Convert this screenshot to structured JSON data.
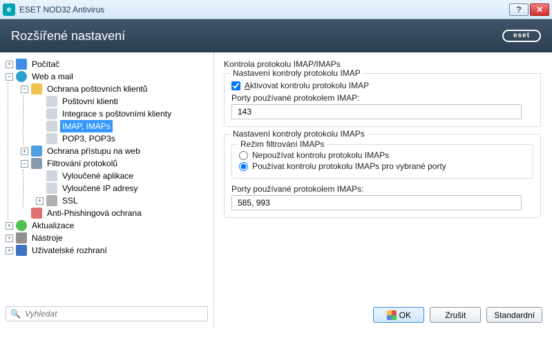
{
  "window": {
    "title": "ESET NOD32 Antivirus",
    "header": "Rozšířené nastavení",
    "brand": "eset"
  },
  "tree": {
    "computer": "Počítač",
    "web_mail": "Web a mail",
    "mail_protection": "Ochrana poštovních klientů",
    "mail_clients": "Poštovní klienti",
    "mail_integration": "Integrace s poštovními klienty",
    "imap": "IMAP, IMAPs",
    "pop3": "POP3, POP3s",
    "web_access": "Ochrana přístupu na web",
    "protocol_filtering": "Filtrování protokolů",
    "excluded_apps": "Vyloučené aplikace",
    "excluded_ips": "Vyloučené IP adresy",
    "ssl": "SSL",
    "antiphishing": "Anti-Phishingová ochrana",
    "update": "Aktualizace",
    "tools": "Nástroje",
    "ui": "Uživatelské rozhraní"
  },
  "search": {
    "placeholder": "Vyhledat"
  },
  "content": {
    "title": "Kontrola protokolu IMAP/IMAPs",
    "imap_group": "Nastavení kontroly protokolu IMAP",
    "imap_checkbox_prefix": "A",
    "imap_checkbox_rest": "ktivovat kontrolu protokolu IMAP",
    "imap_checked": true,
    "imap_ports_label_prefix": "Po",
    "imap_ports_label_u": "r",
    "imap_ports_label_rest": "ty používané protokolem IMAP:",
    "imap_ports_value": "143",
    "imaps_group": "Nastavení kontroly protokolu IMAPs",
    "imaps_mode_group": "Režim filtrování IMAPs",
    "imaps_radio_off_u": "N",
    "imaps_radio_off_rest": "epoužívat kontrolu protokolu IMAPs",
    "imaps_radio_on": "Používat kontrolu protokolu IMAPs pro vybrané porty",
    "imaps_radio_selected": "on",
    "imaps_ports_label": "Porty používané protokolem IMAPs:",
    "imaps_ports_value": "585, 993"
  },
  "buttons": {
    "ok": "OK",
    "cancel": "Zrušit",
    "default": "Standardní"
  }
}
